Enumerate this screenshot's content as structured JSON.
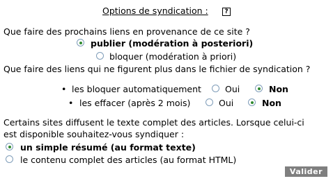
{
  "header": {
    "title": "Options de syndication :",
    "help_label": "?"
  },
  "q1": {
    "question": "Que faire des prochains liens en provenance de ce site ?",
    "opt_publish": "publier (modération à posteriori)",
    "opt_block": "bloquer (modération à priori)"
  },
  "q2": {
    "question": "Que faire des liens qui ne figurent plus dans le fichier de syndication ?",
    "bullet": "•",
    "row1_label": "les bloquer automatiquement",
    "row2_label": "les effacer (après 2 mois)",
    "yes": "Oui",
    "no": "Non"
  },
  "q3": {
    "line1": "Certains sites diffusent le texte complet des articles. Lorsque celui-ci",
    "line2": "est disponible souhaitez-vous syndiquer :",
    "opt_summary": "un simple résumé (au format texte)",
    "opt_full": "le contenu complet des articles (au format HTML)"
  },
  "submit": {
    "label": "Valider"
  },
  "colors": {
    "radio_dot": "#2f8a2f",
    "radio_border": "#7f9db9",
    "button_bg": "#7f7f7f"
  }
}
